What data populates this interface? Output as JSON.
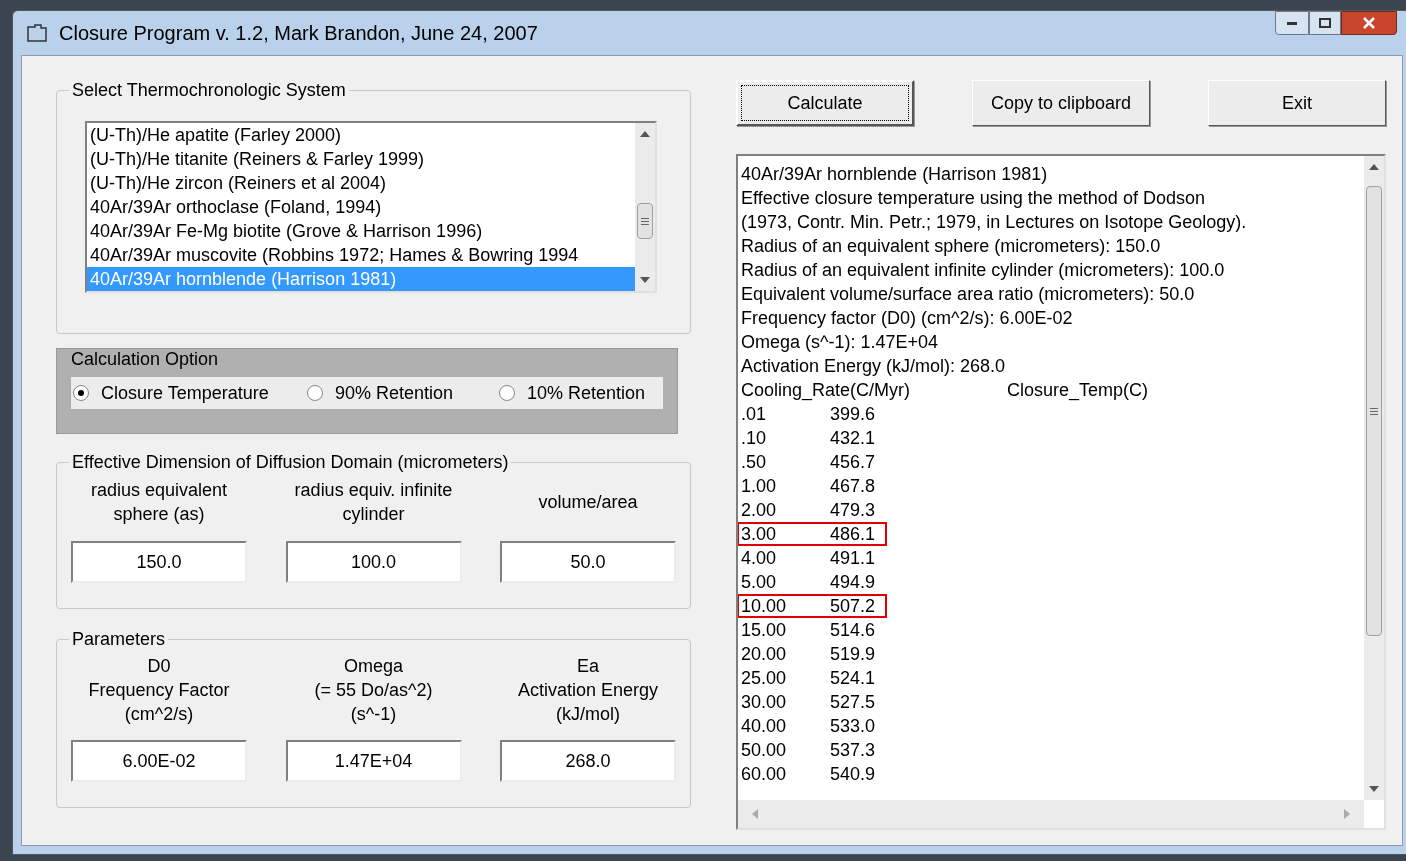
{
  "window": {
    "title": "Closure Program v. 1.2, Mark Brandon, June 24, 2007"
  },
  "system_group": {
    "title": "Select Thermochronologic System",
    "items": [
      {
        "label": "(U-Th)/He apatite (Farley 2000)",
        "selected": false
      },
      {
        "label": "(U-Th)/He titanite (Reiners & Farley 1999)",
        "selected": false
      },
      {
        "label": "(U-Th)/He zircon (Reiners et al 2004)",
        "selected": false
      },
      {
        "label": "40Ar/39Ar orthoclase (Foland, 1994)",
        "selected": false
      },
      {
        "label": "40Ar/39Ar Fe-Mg biotite (Grove & Harrison 1996)",
        "selected": false
      },
      {
        "label": "40Ar/39Ar muscovite (Robbins 1972; Hames & Bowring 1994",
        "selected": false
      },
      {
        "label": "40Ar/39Ar hornblende (Harrison 1981)",
        "selected": true
      }
    ]
  },
  "calculation_option": {
    "title": "Calculation Option",
    "options": [
      {
        "label": "Closure Temperature",
        "selected": true
      },
      {
        "label": "90% Retention",
        "selected": false
      },
      {
        "label": "10% Retention",
        "selected": false
      }
    ]
  },
  "dimension_group": {
    "title": "Effective Dimension of Diffusion Domain (micrometers)",
    "fields": [
      {
        "label": [
          "radius equivalent",
          "sphere (as)"
        ],
        "value": "150.0"
      },
      {
        "label": [
          "radius equiv. infinite",
          "cylinder"
        ],
        "value": "100.0"
      },
      {
        "label": [
          "volume/area"
        ],
        "value": "50.0"
      }
    ]
  },
  "parameters_group": {
    "title": "Parameters",
    "fields": [
      {
        "label": [
          "D0",
          "Frequency Factor",
          "(cm^2/s)"
        ],
        "value": "6.00E-02"
      },
      {
        "label": [
          "Omega",
          "(= 55 Do/as^2)",
          "(s^-1)"
        ],
        "value": "1.47E+04"
      },
      {
        "label": [
          "Ea",
          "Activation Energy",
          "(kJ/mol)"
        ],
        "value": "268.0"
      }
    ]
  },
  "buttons": [
    {
      "label": "Calculate",
      "focused": true
    },
    {
      "label": "Copy to clipboard",
      "focused": false
    },
    {
      "label": "Exit",
      "focused": false
    }
  ],
  "output": {
    "lines": [
      "40Ar/39Ar hornblende (Harrison 1981)",
      "Effective closure temperature using the method of Dodson",
      "(1973, Contr. Min. Petr.; 1979, in Lectures on Isotope Geology).",
      "Radius of an equivalent sphere (micrometers): 150.0",
      "Radius of an equivalent infinite cylinder (micrometers): 100.0",
      "Equivalent volume/surface area ratio (micrometers): 50.0",
      "Frequency factor (D0) (cm^2/s): 6.00E-02",
      "Omega (s^-1): 1.47E+04",
      "Activation Energy (kJ/mol): 268.0"
    ],
    "columns": [
      "Cooling_Rate(C/Myr)",
      "Closure_Temp(C)"
    ],
    "rows": [
      {
        "rate": ".01",
        "temp": "399.6",
        "highlighted": false
      },
      {
        "rate": ".10",
        "temp": "432.1",
        "highlighted": false
      },
      {
        "rate": ".50",
        "temp": "456.7",
        "highlighted": false
      },
      {
        "rate": "1.00",
        "temp": "467.8",
        "highlighted": false
      },
      {
        "rate": "2.00",
        "temp": "479.3",
        "highlighted": false
      },
      {
        "rate": "3.00",
        "temp": "486.1",
        "highlighted": true
      },
      {
        "rate": "4.00",
        "temp": "491.1",
        "highlighted": false
      },
      {
        "rate": "5.00",
        "temp": "494.9",
        "highlighted": false
      },
      {
        "rate": "10.00",
        "temp": "507.2",
        "highlighted": true
      },
      {
        "rate": "15.00",
        "temp": "514.6",
        "highlighted": false
      },
      {
        "rate": "20.00",
        "temp": "519.9",
        "highlighted": false
      },
      {
        "rate": "25.00",
        "temp": "524.1",
        "highlighted": false
      },
      {
        "rate": "30.00",
        "temp": "527.5",
        "highlighted": false
      },
      {
        "rate": "40.00",
        "temp": "533.0",
        "highlighted": false
      },
      {
        "rate": "50.00",
        "temp": "537.3",
        "highlighted": false
      },
      {
        "rate": "60.00",
        "temp": "540.9",
        "highlighted": false
      }
    ]
  }
}
